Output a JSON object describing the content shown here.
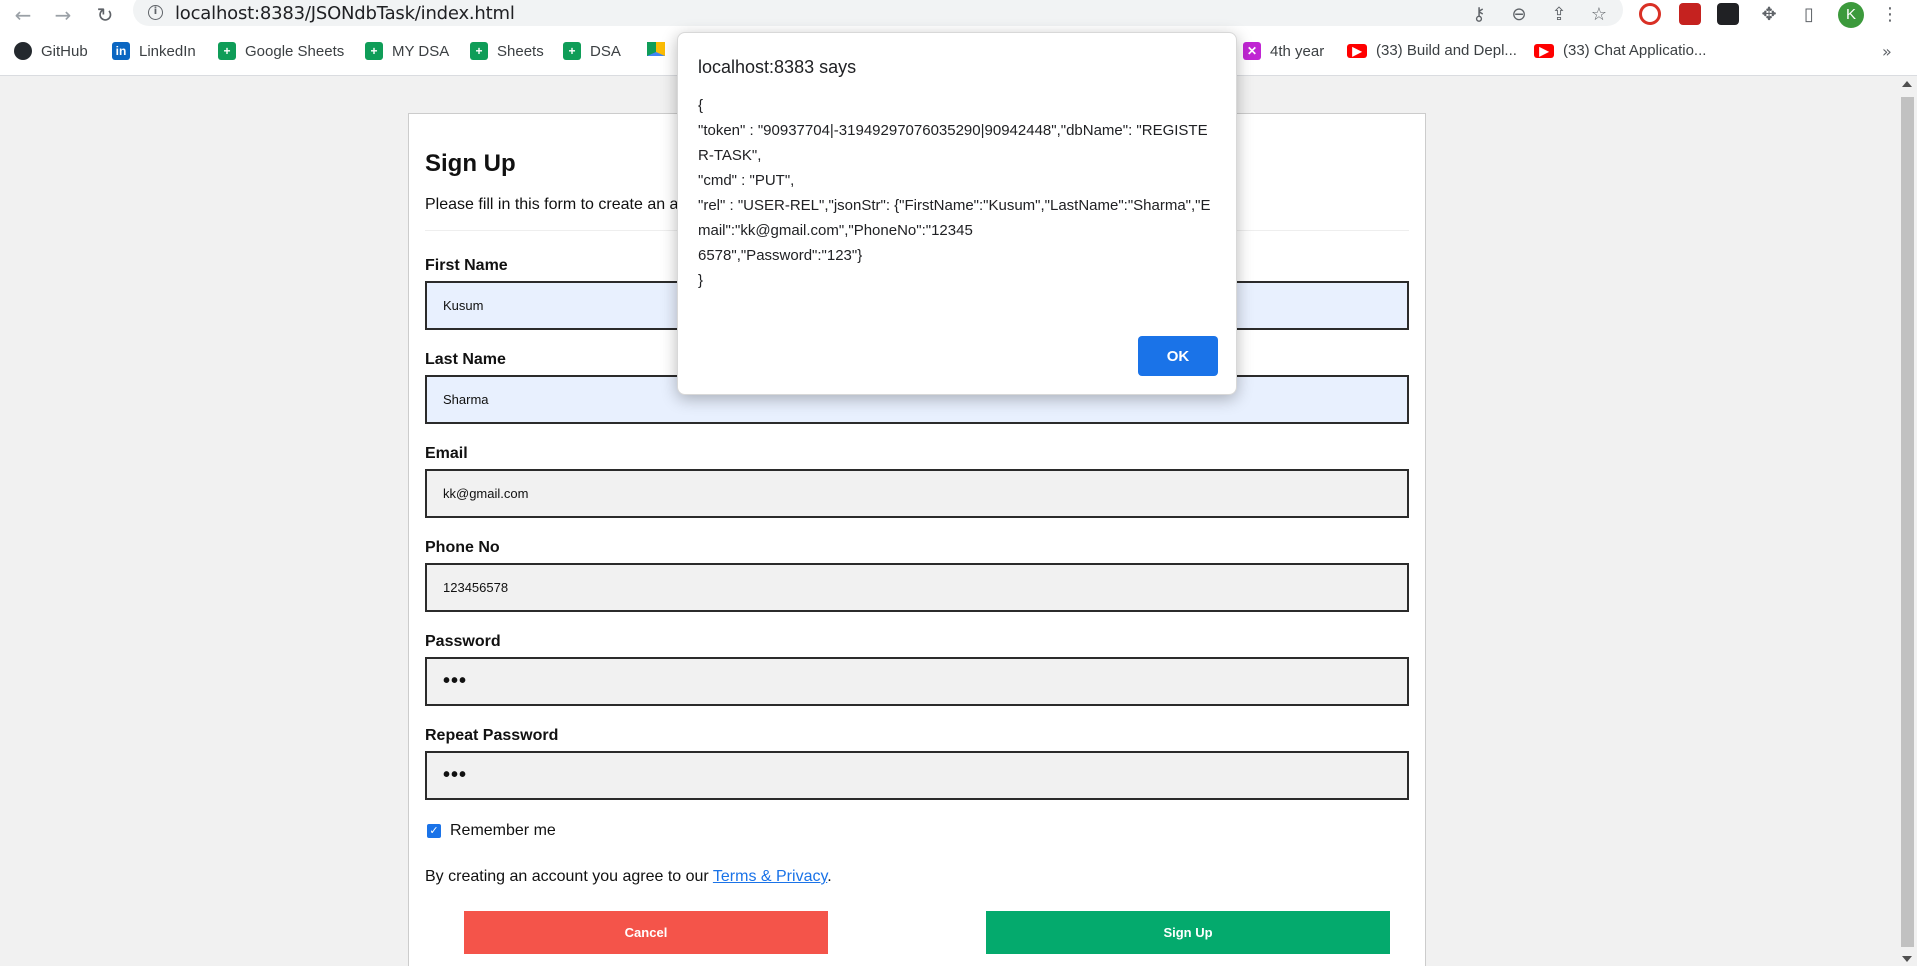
{
  "browser": {
    "url": "localhost:8383/JSONdbTask/index.html",
    "avatar_letter": "K",
    "bookmarks": [
      {
        "label": "GitHub",
        "icon": "github-icon",
        "color": "#24292e"
      },
      {
        "label": "LinkedIn",
        "icon": "linkedin-icon",
        "color": "#0a66c2"
      },
      {
        "label": "Google Sheets",
        "icon": "sheets-icon",
        "color": "#0f9d58"
      },
      {
        "label": "MY DSA",
        "icon": "sheets-icon",
        "color": "#0f9d58"
      },
      {
        "label": "Sheets",
        "icon": "sheets-icon",
        "color": "#0f9d58"
      },
      {
        "label": "DSA",
        "icon": "sheets-icon",
        "color": "#0f9d58"
      },
      {
        "label": "",
        "icon": "google-drive-icon",
        "color": "#fbbc04"
      },
      {
        "label": "4th year",
        "icon": "grid-icon",
        "color": "#c026d3"
      },
      {
        "label": "(33) Build and Depl...",
        "icon": "youtube-icon",
        "color": "#ff0000"
      },
      {
        "label": "(33) Chat Applicatio...",
        "icon": "youtube-icon",
        "color": "#ff0000"
      }
    ],
    "more_bookmarks": "»"
  },
  "form": {
    "title": "Sign Up",
    "subtitle": "Please fill in this form to create an a",
    "fields": [
      {
        "label": "First Name",
        "value": "Kusum"
      },
      {
        "label": "Last Name",
        "value": "Sharma"
      },
      {
        "label": "Email",
        "value": "kk@gmail.com"
      },
      {
        "label": "Phone No",
        "value": "123456578"
      },
      {
        "label": "Password",
        "value": "•••"
      },
      {
        "label": "Repeat Password",
        "value": "•••"
      }
    ],
    "remember_label": "Remember me",
    "remember_checked": true,
    "agree_text": "By creating an account you agree to our ",
    "agree_link": "Terms & Privacy",
    "agree_end": ".",
    "cancel_label": "Cancel",
    "signup_label": "Sign Up"
  },
  "dialog": {
    "title": "localhost:8383 says",
    "message": "{\n\"token\" : \"90937704|-31949297076035290|90942448\",\"dbName\": \"REGISTER-TASK\",\n\"cmd\" : \"PUT\",\n\"rel\" : \"USER-REL\",\"jsonStr\": {\"FirstName\":\"Kusum\",\"LastName\":\"Sharma\",\"Email\":\"kk@gmail.com\",\"PhoneNo\":\"12345\n6578\",\"Password\":\"123\"}\n}",
    "ok_label": "OK"
  }
}
